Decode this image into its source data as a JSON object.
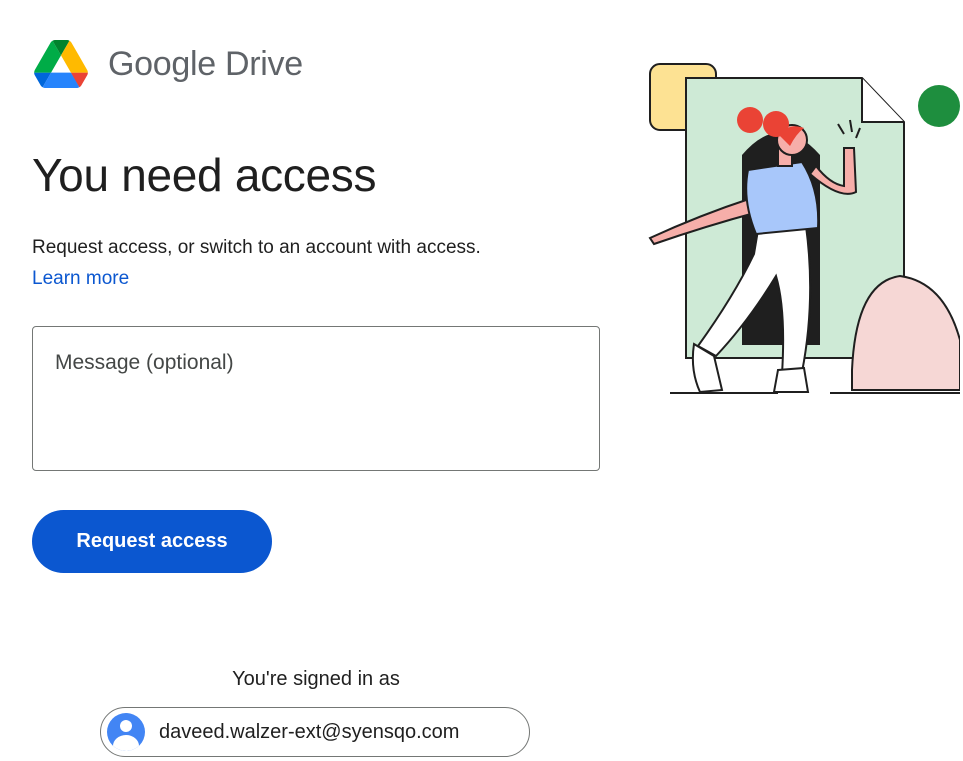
{
  "header": {
    "product_name": "Google Drive",
    "logo_icon": "google-drive-logo-icon",
    "colors": {
      "green": "#00ac47",
      "blue": "#4285f4",
      "yellow": "#ffba00",
      "red": "#ea4335"
    }
  },
  "main": {
    "title": "You need access",
    "subtitle": "Request access, or switch to an account with access.",
    "learn_more": "Learn more",
    "message_placeholder": "Message (optional)",
    "message_value": "",
    "request_button": "Request access"
  },
  "account": {
    "signed_in_label": "You're signed in as",
    "email": "daveed.walzer-ext@syensqo.com",
    "avatar_icon": "account-avatar-icon"
  },
  "illustration": {
    "name": "access-illustration",
    "colors": {
      "doc": "#ceead6",
      "yellow": "#fde293",
      "green_dot": "#1e8e3e",
      "red": "#ea4335",
      "pink": "#f6d7d5",
      "shirt": "#a8c7fa"
    }
  },
  "theme": {
    "accent": "#0b57d0",
    "text": "#1f1f1f",
    "border": "#747775"
  }
}
